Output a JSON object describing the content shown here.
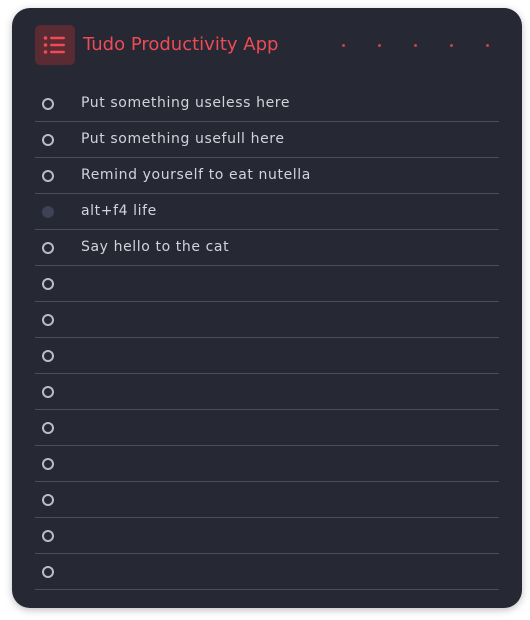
{
  "app": {
    "title": "Tudo Productivity App",
    "menu_icon": "list-menu-icon",
    "accent_color": "#ee4b56",
    "background_color": "#262833"
  },
  "header": {
    "decor_dots": 5
  },
  "todos": [
    {
      "text": "Put something useless here",
      "done": false
    },
    {
      "text": "Put something usefull here",
      "done": false
    },
    {
      "text": "Remind yourself to eat nutella",
      "done": false
    },
    {
      "text": "alt+f4 life",
      "done": true
    },
    {
      "text": "Say hello to the cat",
      "done": false
    },
    {
      "text": "",
      "done": false
    },
    {
      "text": "",
      "done": false
    },
    {
      "text": "",
      "done": false
    },
    {
      "text": "",
      "done": false
    },
    {
      "text": "",
      "done": false
    },
    {
      "text": "",
      "done": false
    },
    {
      "text": "",
      "done": false
    },
    {
      "text": "",
      "done": false
    },
    {
      "text": "",
      "done": false
    }
  ]
}
